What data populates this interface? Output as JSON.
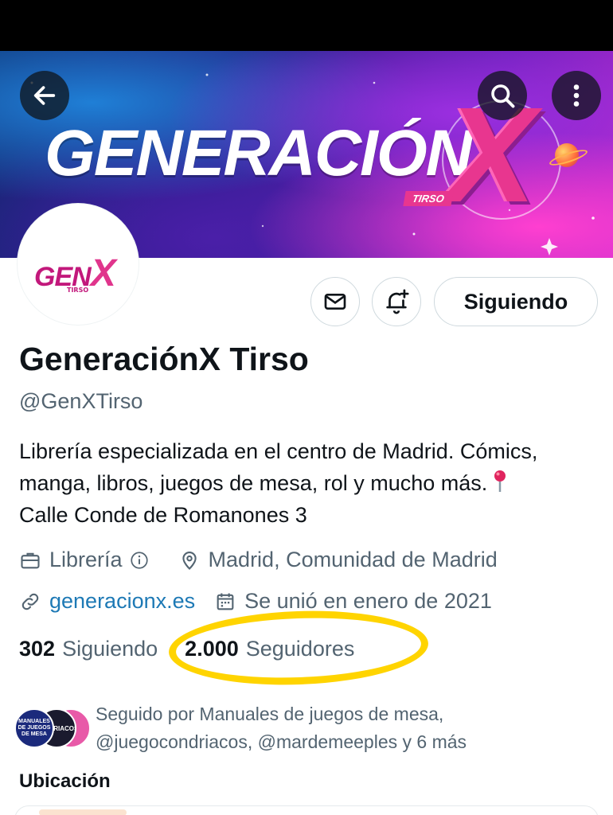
{
  "banner": {
    "title": "GENERACIÓN",
    "title_x": "X",
    "subtitle": "TIRSO"
  },
  "header_buttons": {
    "back_icon": "arrow-left-icon",
    "search_icon": "search-icon",
    "more_icon": "more-vertical-icon"
  },
  "avatar": {
    "text": "GEN",
    "text_x": "X",
    "subtext": "TIRSO"
  },
  "actions": {
    "message_icon": "mail-icon",
    "notify_icon": "bell-plus-icon",
    "following_label": "Siguiendo"
  },
  "profile": {
    "name": "GeneraciónX Tirso",
    "handle": "@GenXTirso",
    "bio_lines": [
      "Librería especializada en el centro de Madrid. Cómics,",
      "manga, libros, juegos de mesa, rol y mucho más.",
      "Calle Conde de Romanones 3"
    ],
    "bio_pin_icon": "round-pushpin-icon",
    "category": "Librería",
    "location": "Madrid, Comunidad de Madrid",
    "website": "generacionx.es",
    "joined": "Se unió en enero de 2021"
  },
  "stats": {
    "following_count": "302",
    "following_label": "Siguiendo",
    "followers_count": "2.000",
    "followers_label": "Seguidores",
    "highlight_color": "#ffd400"
  },
  "followed_by": {
    "line1": "Seguido por Manuales de juegos de mesa,",
    "line2": "@juegocondriacos, @mardemeeples y 6 más",
    "avatar1_text": "MANUALES DE JUEGOS DE MESA",
    "avatar2_text": "CONDRIACOS"
  },
  "section": {
    "title": "Ubicación"
  },
  "colors": {
    "text_primary": "#0f1419",
    "text_secondary": "#536471",
    "link": "#1d79b5",
    "brand_pink": "#e8368f"
  }
}
